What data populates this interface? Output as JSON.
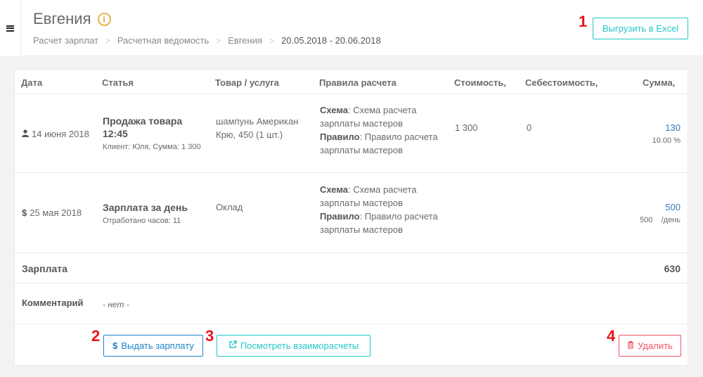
{
  "header": {
    "title": "Евгения",
    "info_icon": "i",
    "breadcrumb": [
      "Расчет зарплат",
      "Расчетная ведомость",
      "Евгения",
      "20.05.2018 - 20.06.2018"
    ],
    "breadcrumb_sep": ">",
    "excel_button": "Выгрузить в Excel"
  },
  "markers": [
    "1",
    "2",
    "3",
    "4"
  ],
  "table": {
    "columns": [
      "Дата",
      "Статья",
      "Товар / услуга",
      "Правила расчета",
      "Стоимость,",
      "Себестоимость,",
      "Сумма,"
    ],
    "rows": [
      {
        "date_icon": "user-icon",
        "date": "14 июня 2018",
        "title": "Продажа товара 12:45",
        "subtitle": "Клиент: Юля, Сумма: 1 300",
        "product": "шампунь Американ Крю, 450 (1 шт.)",
        "scheme_label": "Схема",
        "scheme_value": ": Схема расчета зарплаты мастеров",
        "rule_label": "Правило",
        "rule_value": ": Правило расчета зарплаты мастеров",
        "cost": "1 300",
        "self_cost": "0",
        "amount": "130",
        "amount_sub": "10.00 %"
      },
      {
        "date_icon": "dollar-icon",
        "date": "25 мая 2018",
        "title": "Зарплата за день",
        "subtitle": "Отработано часов: 11",
        "product": "Оклад",
        "scheme_label": "Схема",
        "scheme_value": ": Схема расчета зарплаты мастеров",
        "rule_label": "Правило",
        "rule_value": ": Правило расчета зарплаты мастеров",
        "cost": "",
        "self_cost": "",
        "amount": "500",
        "amount_sub": "500    /день"
      }
    ]
  },
  "summary": {
    "salary_label": "Зарплата",
    "salary_value": "630",
    "comment_label": "Комментарий",
    "comment_value": "- нет -"
  },
  "actions": {
    "pay": "Выдать зарплату",
    "view": "Посмотреть взаиморасчеты",
    "delete": "Удалить"
  },
  "colors": {
    "accent_info": "#23c6c8",
    "accent_primary": "#1c84c6",
    "accent_danger": "#ed5565",
    "marker": "#e8141b"
  }
}
